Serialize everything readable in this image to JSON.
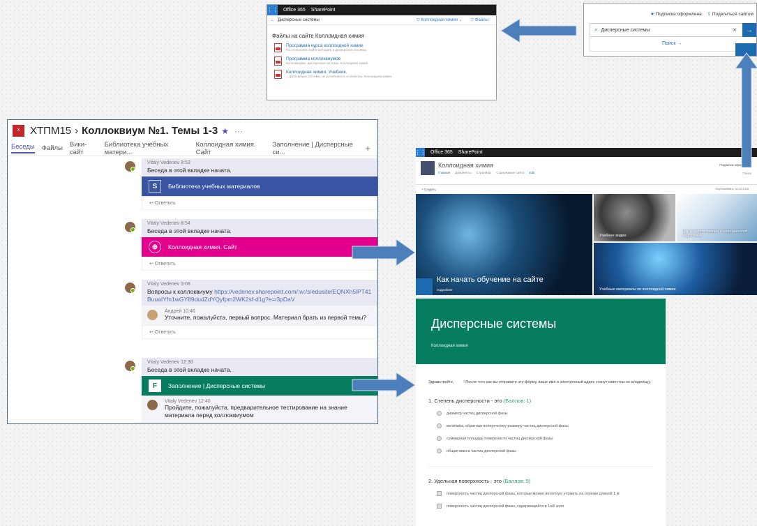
{
  "colors": {
    "teams_purple": "#4f52b2",
    "sp_blue": "#1c6bb0",
    "site_magenta": "#e3008c",
    "forms_green": "#077d5f",
    "library_blue": "#3955a3",
    "arrow_blue": "#4d7fbb"
  },
  "sp_search": {
    "suite_label": "Office 365",
    "app_label": "SharePoint",
    "query": "Дисперсные системы",
    "filter_site": "Коллоидная химия",
    "filter_files": "Файлы",
    "results_title": "Файлы на сайте Коллоидная химия",
    "results": [
      {
        "title": "Программа курса коллоидной химии",
        "desc": "На этом можно найти методику и дисперсные системы."
      },
      {
        "title": "Программа коллоквиумов",
        "desc": "Коллоквиумы: дисперсные системы. Коллоидная химия."
      },
      {
        "title": "Коллоидная химия. Учебник.",
        "desc": "…дисперсные системы, их устойчивость и свойства. Коллоидная химия."
      }
    ],
    "icons": {
      "waffle": "app-launcher-icon",
      "back": "back-arrow-icon",
      "doc": "pdf-document-icon"
    }
  },
  "top_search": {
    "subscribe_label": "Подписка оформлена",
    "share_label": "Поделиться сайтом",
    "query": "Дисперсные системы",
    "search_link": "Поиск →"
  },
  "teams": {
    "logo_text": "Х",
    "team_name": "ХТПМ15",
    "channel_name": "Коллоквиум №1. Темы 1-3",
    "tabs": [
      "Беседы",
      "Файлы",
      "Вики-сайт",
      "Библиотека учебных матери...",
      "Коллоидная химия. Сайт",
      "Заполнение | Дисперсные си..."
    ],
    "threads": [
      {
        "author": "Vitaly Vedenev",
        "time": "8:53",
        "text": "Беседа в этой вкладке начата.",
        "card_label": "Библиотека учебных материалов",
        "reply_label": "Ответить"
      },
      {
        "author": "Vitaly Vedenev",
        "time": "8:54",
        "text": "Беседа в этой вкладке начата.",
        "card_label": "Коллоидная химия. Сайт",
        "reply_label": "Ответить"
      },
      {
        "author": "Vitaly Vedenev",
        "time": "9:08",
        "text_prefix": "Вопросы к коллоквиуму",
        "link": "https://vedenev.sharepoint.com/:w:/s/edusite/EQNXh5lPT41BuuaIYfn1wGY89dudZdYQyfpm2WK2sf-d1g?e=i3pDaV",
        "reply_author": "Андрей",
        "reply_time": "10:46",
        "reply_text": "Уточните, пожалуйста, первый вопрос. Материал брать из первой темы?",
        "reply_label": "Ответить"
      },
      {
        "author": "Vitaly Vedenev",
        "time": "12:38",
        "text": "Беседа в этой вкладке начата.",
        "card_label": "Заполнение | Дисперсные системы",
        "reply_author": "Vitaly Vedenev",
        "reply_time": "12:40",
        "reply_text": "Пройдите, пожалуйста, предварительное тестирование на знание материала перед коллоквиумом"
      }
    ]
  },
  "sp_site": {
    "suite_label": "Office 365",
    "app_label": "SharePoint",
    "site_name": "Коллоидная химия",
    "nav": [
      "Главная",
      "Документы",
      "Страницы",
      "Содержимое сайта",
      "Edit"
    ],
    "subscribe": "Подписка оформлена",
    "find": "Поиск",
    "new_label": "+ Создать",
    "published": "Опубликовано 16.03.2018",
    "hero_title": "Как начать обучение на сайте",
    "hero_sub": "подробнее",
    "tile_video": "Учебное видео",
    "tile_tests": "Центр тестирования и практической подготовки",
    "tile_materials": "Учебные материалы по коллоидной химии"
  },
  "forms": {
    "title": "Дисперсные системы",
    "subtitle": "Коллоидная химия",
    "intro_greeting": "Здравствуйте,",
    "intro_text": "! После того как вы отправите эту форму, ваше имя и электронный адрес станут известны ее владельцу.",
    "q1": "1. Степень дисперсности - это",
    "q1_points": "(Баллов: 1)",
    "q1_options": [
      "диаметр частиц дисперсной фазы",
      "величина, обратная поперечному размеру частиц дисперсной фазы",
      "суммарная площадь поверхности частиц дисперсной фазы",
      "общая масса частиц дисперсной фазы"
    ],
    "q2": "2. Удельная поверхность - это",
    "q2_points": "(Баллов: 5)",
    "q2_options": [
      "поверхность частиц дисперсной фазы, которые можно вплотную уложить на отрезке длиной 1 м",
      "поверхность частиц дисперсной фазы, содержащейся в 1м3 золя"
    ]
  }
}
